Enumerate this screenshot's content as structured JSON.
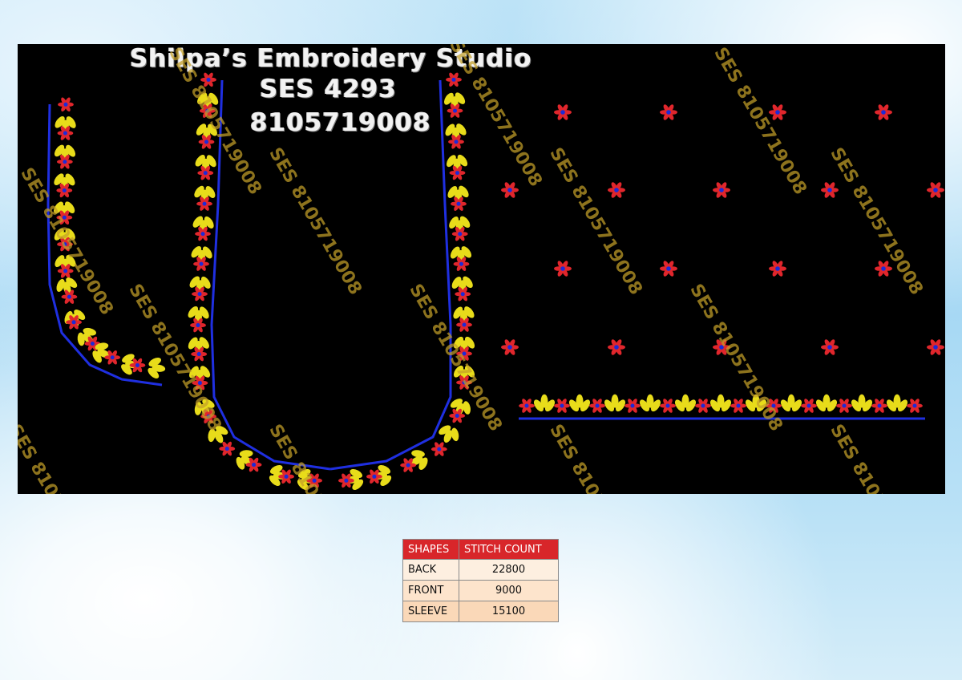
{
  "design": {
    "title": "Shilpa’s Embroidery Studio",
    "code": "SES 4293",
    "phone": "8105719008",
    "watermark_text": "SES 8105719008",
    "colors": {
      "background": "#000000",
      "outline": "#1f2fe0",
      "leaf": "#e8dc1a",
      "flower": "#e0262c",
      "flower_center": "#1b2bd8",
      "watermark": "#c4a028"
    }
  },
  "table": {
    "headers": [
      "SHAPES",
      "STITCH COUNT"
    ],
    "rows": [
      {
        "shape": "BACK",
        "count": "22800"
      },
      {
        "shape": "FRONT",
        "count": "9000"
      },
      {
        "shape": "SLEEVE",
        "count": "15100"
      }
    ],
    "header_color": "#d8262a"
  }
}
